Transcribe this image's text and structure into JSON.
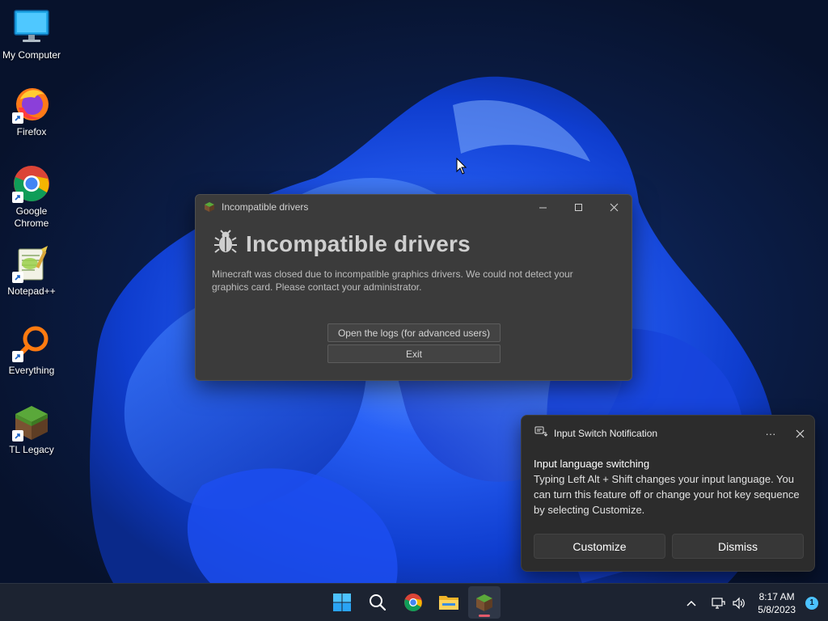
{
  "desktop": {
    "icons": [
      {
        "label": "My Computer"
      },
      {
        "label": "Firefox"
      },
      {
        "label": "Google Chrome"
      },
      {
        "label": "Notepad++"
      },
      {
        "label": "Everything"
      },
      {
        "label": "TL Legacy"
      }
    ]
  },
  "dialog": {
    "window_title": "Incompatible drivers",
    "heading": "Incompatible drivers",
    "message": "Minecraft was closed due to incompatible graphics drivers. We could not detect your graphics card. Please contact your administrator.",
    "open_logs_label": "Open the logs (for advanced users)",
    "exit_label": "Exit"
  },
  "notification": {
    "app_name": "Input Switch Notification",
    "title": "Input language switching",
    "body": "Typing Left Alt + Shift changes your input language. You can turn this feature off or change your hot key sequence by selecting Customize.",
    "more_label": "···",
    "customize_label": "Customize",
    "dismiss_label": "Dismiss"
  },
  "taskbar": {
    "items": [
      "start",
      "search",
      "chrome",
      "file-explorer",
      "tl-legacy"
    ],
    "active_item": "tl-legacy",
    "time": "8:17 AM",
    "date": "5/8/2023",
    "notification_count": "1"
  },
  "colors": {
    "accent": "#4cc2ff",
    "wallpaper_bloom": "#1f5eff",
    "dialog_bg": "#3b3b3b",
    "toast_bg": "#2c2c2c",
    "taskbar_bg": "#1c2331"
  }
}
